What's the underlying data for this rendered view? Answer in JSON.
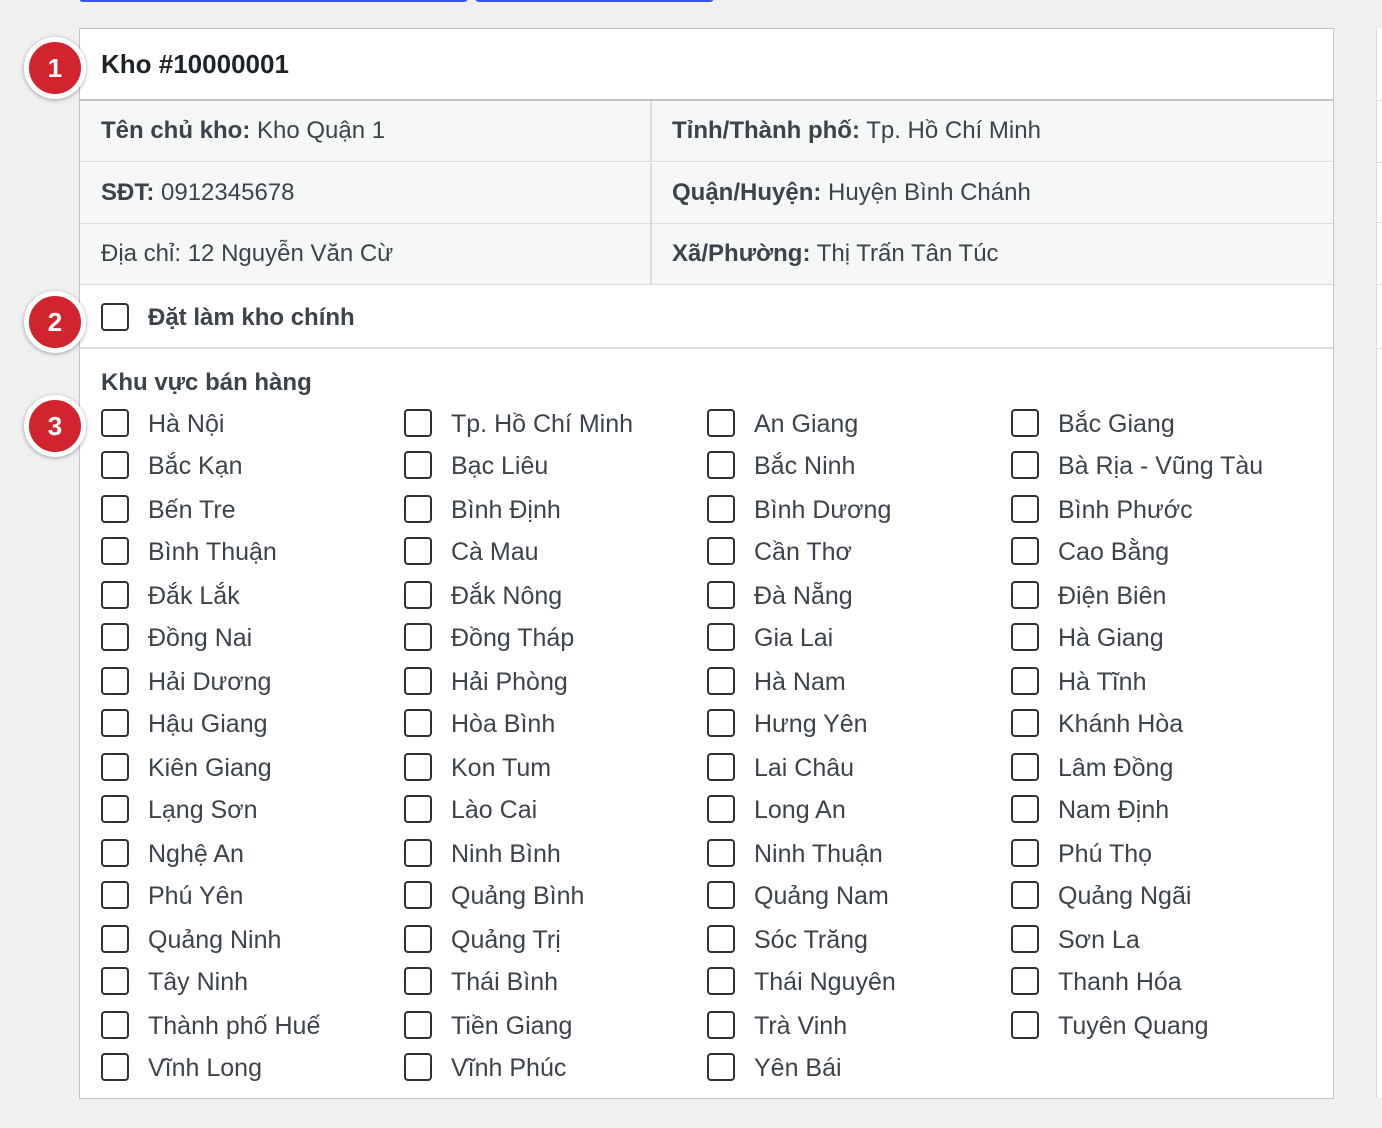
{
  "warehouse": {
    "title": "Kho #10000001",
    "owner": {
      "label": "Tên chủ kho:",
      "value": "Kho Quận 1"
    },
    "province": {
      "label": "Tỉnh/Thành phố:",
      "value": "Tp. Hồ Chí Minh"
    },
    "phone": {
      "label": "SĐT:",
      "value": "0912345678"
    },
    "district": {
      "label": "Quận/Huyện:",
      "value": "Huyện Bình Chánh"
    },
    "address": {
      "label": "Địa chỉ:",
      "value": "12 Nguyễn Văn Cừ"
    },
    "ward": {
      "label": "Xã/Phường:",
      "value": "Thị Trấn Tân Túc"
    }
  },
  "main_warehouse": {
    "label": "Đặt làm kho chính",
    "checked": false
  },
  "sales_area": {
    "title": "Khu vực bán hàng",
    "provinces": [
      "Hà Nội",
      "Tp. Hồ Chí Minh",
      "An Giang",
      "Bắc Giang",
      "Bắc Kạn",
      "Bạc Liêu",
      "Bắc Ninh",
      "Bà Rịa - Vũng Tàu",
      "Bến Tre",
      "Bình Định",
      "Bình Dương",
      "Bình Phước",
      "Bình Thuận",
      "Cà Mau",
      "Cần Thơ",
      "Cao Bằng",
      "Đắk Lắk",
      "Đắk Nông",
      "Đà Nẵng",
      "Điện Biên",
      "Đồng Nai",
      "Đồng Tháp",
      "Gia Lai",
      "Hà Giang",
      "Hải Dương",
      "Hải Phòng",
      "Hà Nam",
      "Hà Tĩnh",
      "Hậu Giang",
      "Hòa Bình",
      "Hưng Yên",
      "Khánh Hòa",
      "Kiên Giang",
      "Kon Tum",
      "Lai Châu",
      "Lâm Đồng",
      "Lạng Sơn",
      "Lào Cai",
      "Long An",
      "Nam Định",
      "Nghệ An",
      "Ninh Bình",
      "Ninh Thuận",
      "Phú Thọ",
      "Phú Yên",
      "Quảng Bình",
      "Quảng Nam",
      "Quảng Ngãi",
      "Quảng Ninh",
      "Quảng Trị",
      "Sóc Trăng",
      "Sơn La",
      "Tây Ninh",
      "Thái Bình",
      "Thái Nguyên",
      "Thanh Hóa",
      "Thành phố Huế",
      "Tiền Giang",
      "Trà Vinh",
      "Tuyên Quang",
      "Vĩnh Long",
      "Vĩnh Phúc",
      "Yên Bái"
    ]
  },
  "badges": [
    "1",
    "2",
    "3"
  ]
}
